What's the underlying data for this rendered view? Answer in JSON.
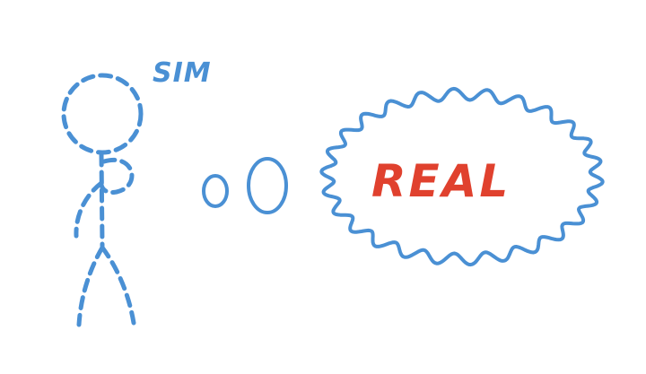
{
  "figure_label": "SIM",
  "cloud_label": "REAL",
  "colors": {
    "sketch_blue": "#4a90d4",
    "real_red": "#e0412e",
    "background": "#ffffff"
  }
}
